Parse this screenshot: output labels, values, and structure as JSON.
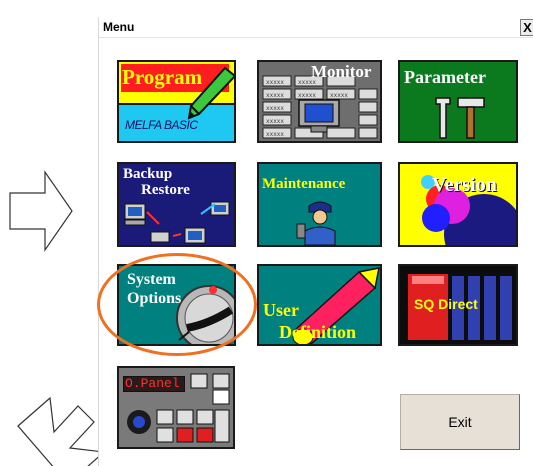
{
  "window": {
    "title": "Menu",
    "close_glyph": "X"
  },
  "tiles": {
    "program": {
      "title": "Program",
      "subtitle": "MELFA BASIC"
    },
    "monitor": {
      "title": "Monitor",
      "cell_text": "xxxxx"
    },
    "parameter": {
      "title": "Parameter"
    },
    "backup": {
      "title_line1": "Backup",
      "title_line2": "Restore"
    },
    "maintenance": {
      "title": "Maintenance"
    },
    "version": {
      "title": "Version"
    },
    "system_options": {
      "title_line1": "System",
      "title_line2": "Options"
    },
    "user_definition": {
      "title_line1": "User",
      "title_line2": "Definition"
    },
    "sq_direct": {
      "title": "SQ Direct"
    },
    "operation_panel": {
      "title": "O.Panel"
    }
  },
  "exit_button": {
    "label": "Exit"
  },
  "colors": {
    "highlight_ring": "#f07020"
  }
}
